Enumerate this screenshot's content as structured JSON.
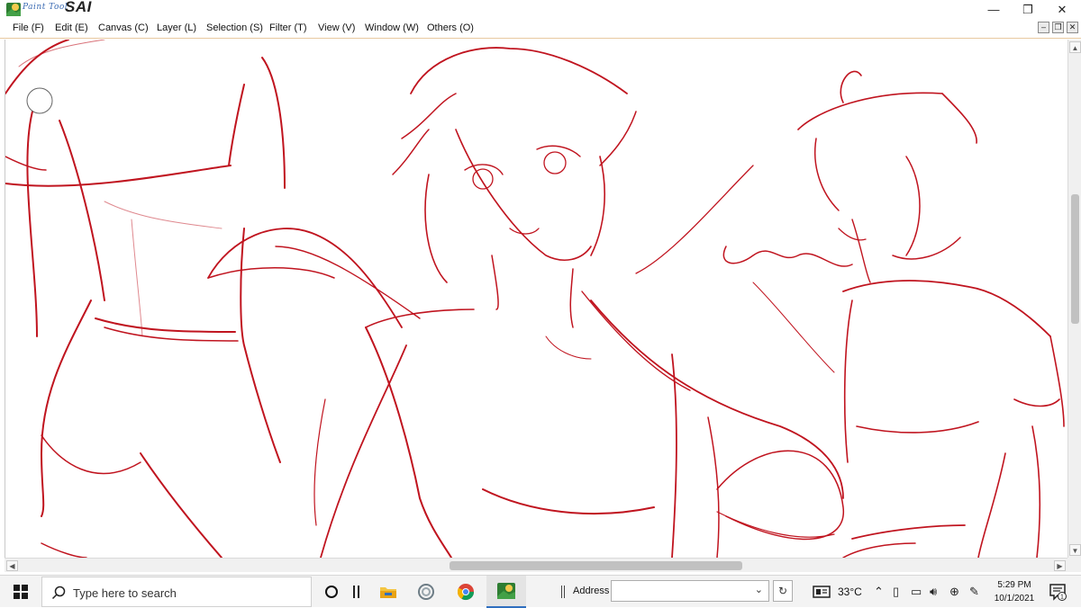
{
  "app": {
    "brand_small": "Paint Tool",
    "brand_big": "SAI"
  },
  "window_controls": {
    "minimize": "—",
    "maximize": "❐",
    "close": "✕"
  },
  "menu": [
    {
      "label": "File (F)"
    },
    {
      "label": "Edit (E)"
    },
    {
      "label": "Canvas (C)"
    },
    {
      "label": "Layer (L)"
    },
    {
      "label": "Selection (S)"
    },
    {
      "label": "Filter (T)"
    },
    {
      "label": "View (V)"
    },
    {
      "label": "Window (W)"
    },
    {
      "label": "Others (O)"
    }
  ],
  "canvas": {
    "sketch_color": "#c0141f",
    "content": "red line sketch of three figures"
  },
  "scrollbars": {
    "arrow_up": "▲",
    "arrow_down": "▼",
    "arrow_left": "◀",
    "arrow_right": "▶"
  },
  "taskbar": {
    "search_placeholder": "Type here to search",
    "address_label": "Address",
    "address_value": "",
    "temperature": "33°C",
    "time": "5:29 PM",
    "date": "10/1/2021",
    "notification_count": "1",
    "accent_color": "#2f6fbf"
  }
}
